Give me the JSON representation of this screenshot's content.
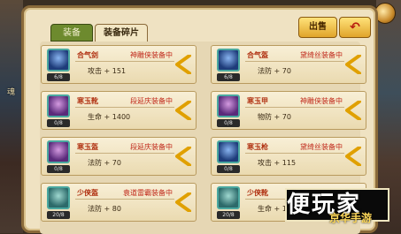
{
  "tabs": [
    {
      "label": "装备"
    },
    {
      "label": "装备碎片"
    }
  ],
  "toolbar": {
    "sell_label": "出售",
    "back_label": "↶"
  },
  "side_text": {
    "left_top": "魂",
    "right_bottom": "游"
  },
  "cards": [
    {
      "name": "合气剑",
      "owner": "神雕侠装备中",
      "stat": "攻击 + 151",
      "count": "6/8",
      "thumb": "blue"
    },
    {
      "name": "合气盔",
      "owner": "黛绮丝装备中",
      "stat": "法防 + 70",
      "count": "6/8",
      "thumb": "blue"
    },
    {
      "name": "寒玉靴",
      "owner": "段延庆装备中",
      "stat": "生命 + 1400",
      "count": "0/8",
      "thumb": "purple"
    },
    {
      "name": "寒玉甲",
      "owner": "神雕侠装备中",
      "stat": "物防 + 70",
      "count": "0/8",
      "thumb": "purple"
    },
    {
      "name": "寒玉盔",
      "owner": "段延庆装备中",
      "stat": "法防 + 70",
      "count": "0/8",
      "thumb": "purple"
    },
    {
      "name": "寒玉枪",
      "owner": "黛绮丝装备中",
      "stat": "攻击 + 115",
      "count": "0/8",
      "thumb": "blue"
    },
    {
      "name": "少侠盔",
      "owner": "袁道雷霸装备中",
      "stat": "法防 + 80",
      "count": "20/8",
      "thumb": "green"
    },
    {
      "name": "少侠靴",
      "owner": "黛绮丝装备中",
      "stat": "生命 + 1600",
      "count": "20/8",
      "thumb": "green"
    }
  ],
  "watermark": {
    "big": "便玩家",
    "small": "京华手游"
  },
  "colors": {
    "panel_bg": "#efe2c2",
    "accent_red": "#c0281a",
    "arrow": "#e0a000"
  }
}
